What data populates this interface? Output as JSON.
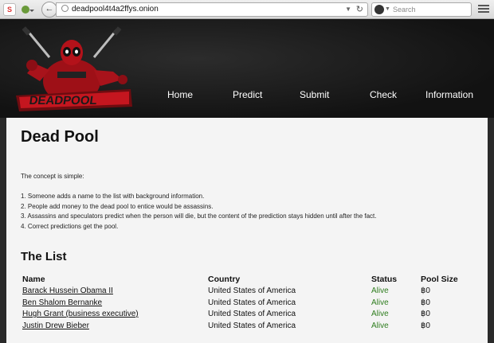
{
  "browser": {
    "url": "deadpool4t4a2ffys.onion",
    "search_placeholder": "Search"
  },
  "nav": [
    "Home",
    "Predict",
    "Submit",
    "Check",
    "Information"
  ],
  "page": {
    "title": "Dead Pool",
    "intro": "The concept is simple:",
    "steps": [
      "1. Someone adds a name to the list with background information.",
      "2. People add money to the dead pool to entice would be assassins.",
      "3. Assassins and speculators predict when the person will die, but the content of the prediction stays hidden until after the fact.",
      "4. Correct predictions get the pool."
    ],
    "list_title": "The List",
    "table": {
      "headers": [
        "Name",
        "Country",
        "Status",
        "Pool Size"
      ],
      "rows": [
        {
          "name": "Barack Hussein Obama II",
          "country": "United States of America",
          "status": "Alive",
          "pool": "฿0"
        },
        {
          "name": "Ben Shalom Bernanke",
          "country": "United States of America",
          "status": "Alive",
          "pool": "฿0"
        },
        {
          "name": "Hugh Grant (business executive)",
          "country": "United States of America",
          "status": "Alive",
          "pool": "฿0"
        },
        {
          "name": "Justin Drew Bieber",
          "country": "United States of America",
          "status": "Alive",
          "pool": "฿0"
        }
      ]
    }
  },
  "colors": {
    "status_alive": "#2e7d1e",
    "header_bg": "#141414",
    "logo_red": "#b3121a"
  },
  "icons": [
    "extension-s-icon",
    "onion-icon",
    "back-arrow-icon",
    "globe-icon",
    "reload-icon",
    "search-engine-icon",
    "menu-icon",
    "deadpool-logo"
  ]
}
